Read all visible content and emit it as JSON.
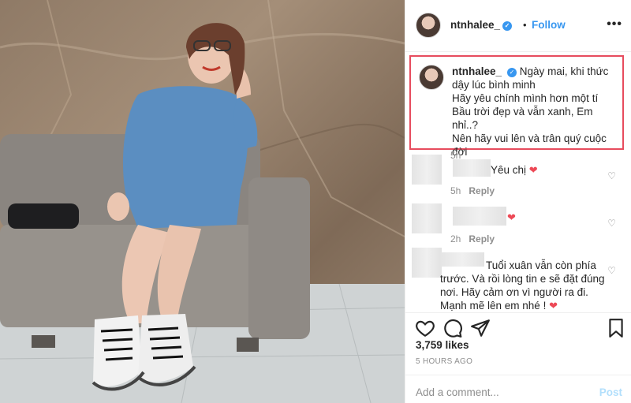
{
  "post": {
    "username": "ntnhalee_",
    "follow_label": "Follow",
    "separator": "•",
    "more_label": "•••",
    "verified_mark": "✓"
  },
  "caption": {
    "username": "ntnhalee_",
    "lines": [
      "Ngày mai, khi thức dậy lúc bình minh",
      "Hãy yêu chính mình hơn một tí",
      "Bầu trời đẹp và vẫn xanh, Em nhỉ..?",
      "Nên hãy vui lên và trân quý cuộc đời"
    ],
    "emoji": "💋",
    "time": "5h",
    "highlight_color": "#e74c5e"
  },
  "comments": [
    {
      "text": "Yêu chị",
      "emoji": "❤",
      "time": "5h",
      "reply": "Reply"
    },
    {
      "text": "",
      "emoji": "❤",
      "time": "2h",
      "reply": "Reply"
    },
    {
      "text": "Tuổi xuân vẫn còn phía trước. Và rồi lòng tin e sẽ đặt đúng nơi. Hãy cảm ơn vì người ra đi. Mạnh mẽ lên em nhé !",
      "emoji": "❤",
      "time": "",
      "reply": ""
    }
  ],
  "likes": "3,759 likes",
  "time_ago": "5 HOURS AGO",
  "add_comment": {
    "placeholder": "Add a comment...",
    "post_label": "Post"
  },
  "icons": {
    "like": "heart-outline-icon",
    "comment": "speech-bubble-icon",
    "share": "paper-plane-icon",
    "save": "bookmark-icon",
    "comment_like": "small-heart-icon"
  },
  "colors": {
    "accent": "#3897f0",
    "heart": "#ed4956",
    "post_disabled": "#b2dffc"
  }
}
